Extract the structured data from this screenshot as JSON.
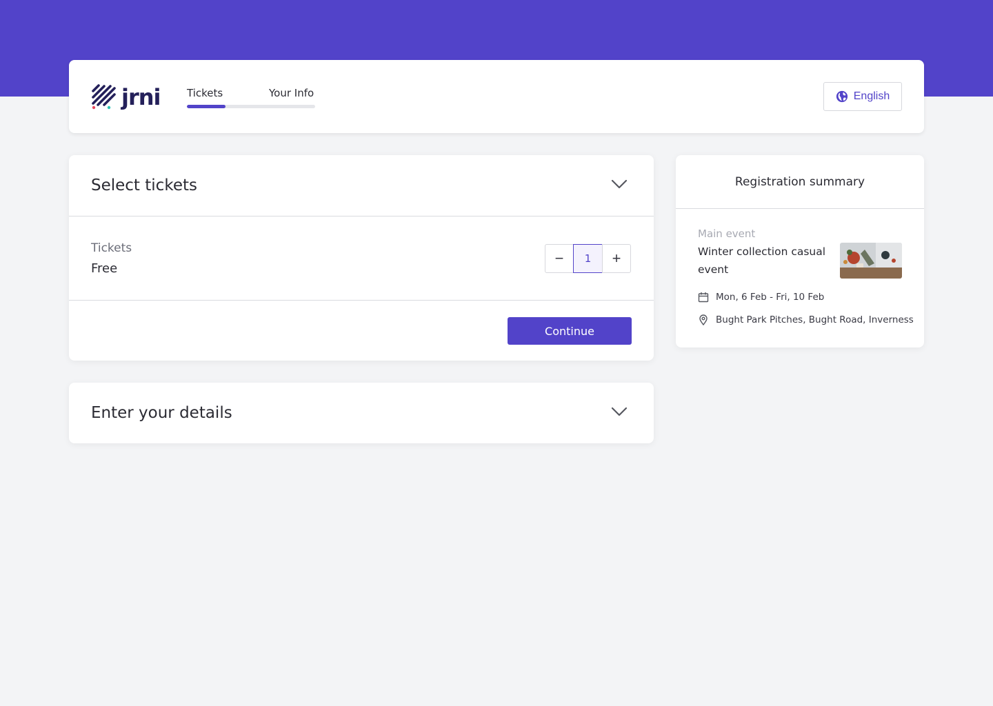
{
  "header": {
    "logo_text": "jrni",
    "steps": [
      {
        "label": "Tickets"
      },
      {
        "label": "Your Info"
      }
    ],
    "progress": 0.3,
    "language": "English"
  },
  "tickets_section": {
    "title": "Select tickets",
    "ticket": {
      "name": "Tickets",
      "price": "Free",
      "quantity": "1",
      "minus_symbol": "−",
      "plus_symbol": "+"
    },
    "continue_label": "Continue"
  },
  "details_section": {
    "title": "Enter your details"
  },
  "summary": {
    "title": "Registration summary",
    "event_label": "Main event",
    "event_name": "Winter collection casual event",
    "dates": "Mon, 6 Feb - Fri, 10 Feb",
    "location": "Bught Park Pitches, Bught Road, Inverness"
  },
  "icons": {
    "language": "globe-icon",
    "expand": "chevron-down-icon",
    "date": "calendar-icon",
    "location": "map-pin-icon"
  },
  "colors": {
    "brand": "#5243c9",
    "logo": "#24205a",
    "background": "#f3f4f6"
  }
}
